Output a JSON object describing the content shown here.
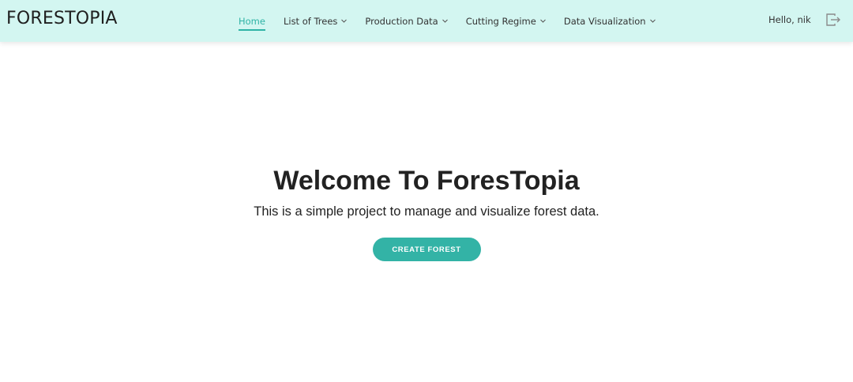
{
  "brand": "FORESTOPIA",
  "nav": {
    "items": [
      {
        "label": "Home",
        "active": true,
        "has_dropdown": false
      },
      {
        "label": "List of Trees",
        "active": false,
        "has_dropdown": true
      },
      {
        "label": "Production Data",
        "active": false,
        "has_dropdown": true
      },
      {
        "label": "Cutting Regime",
        "active": false,
        "has_dropdown": true
      },
      {
        "label": "Data Visualization",
        "active": false,
        "has_dropdown": true
      }
    ],
    "greeting": "Hello, nik",
    "logout_icon": "logout-icon"
  },
  "hero": {
    "title": "Welcome To ForesTopia",
    "subtitle": "This is a simple project to manage and visualize forest data.",
    "cta_label": "CREATE FOREST"
  },
  "colors": {
    "navbar_bg": "#d3f6f1",
    "accent": "#33b3a6",
    "text": "#222222"
  }
}
